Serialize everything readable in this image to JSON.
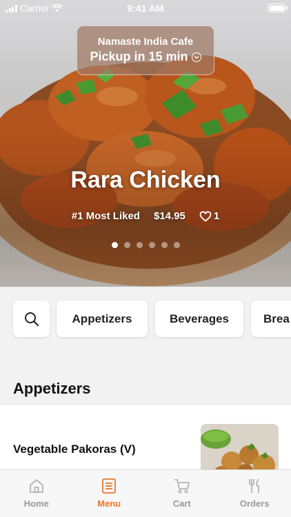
{
  "status_bar": {
    "carrier": "Carrier",
    "time": "9:41 AM"
  },
  "restaurant": {
    "name": "Namaste India Cafe",
    "pickup": "Pickup in 15 min"
  },
  "featured": {
    "name": "Rara Chicken",
    "rank": "#1 Most Liked",
    "price": "$14.95",
    "likes": "1",
    "page_count": 6,
    "active_page": 0
  },
  "categories": [
    "Appetizers",
    "Beverages",
    "Brea"
  ],
  "menu": {
    "section_title": "Appetizers",
    "items": [
      {
        "name": "Vegetable Pakoras (V)"
      }
    ]
  },
  "tabs": [
    {
      "label": "Home",
      "icon": "home-icon"
    },
    {
      "label": "Menu",
      "icon": "menu-icon",
      "active": true
    },
    {
      "label": "Cart",
      "icon": "cart-icon"
    },
    {
      "label": "Orders",
      "icon": "orders-icon"
    }
  ],
  "colors": {
    "accent": "#e8772e",
    "inactive_tab": "#999999"
  }
}
